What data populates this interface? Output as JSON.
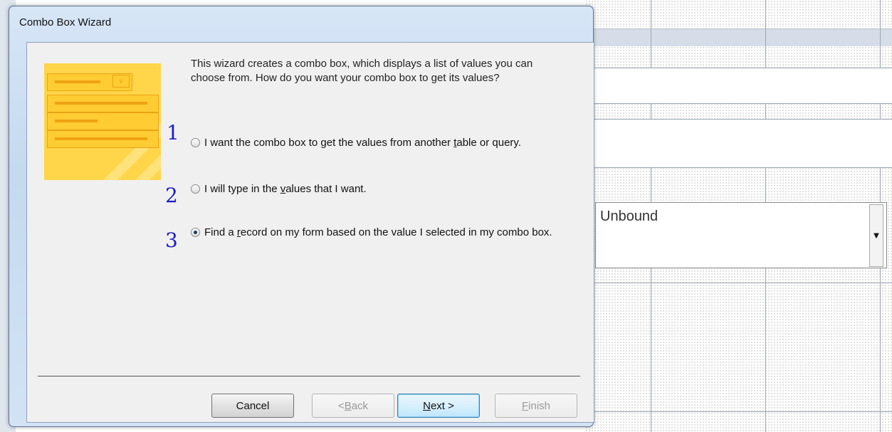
{
  "dialog": {
    "title": "Combo Box Wizard",
    "intro": "This wizard creates a combo box, which displays a list of values you can choose from.  How do you want your combo box to get its values?",
    "options": [
      {
        "pre": "I want the combo box to get the values from another ",
        "key": "t",
        "post": "able or query.",
        "selected": false,
        "annotation": "1"
      },
      {
        "pre": "I will type in the ",
        "key": "v",
        "post": "alues that I want.",
        "selected": false,
        "annotation": "2"
      },
      {
        "pre": "Find a ",
        "key": "r",
        "post": "ecord on my form based on the value I selected in my combo box.",
        "selected": true,
        "annotation": "3"
      }
    ],
    "buttons": {
      "cancel": "Cancel",
      "back_pre": "< ",
      "back_key": "B",
      "back_post": "ack",
      "next_key": "N",
      "next_post": "ext >",
      "finish_key": "F",
      "finish_post": "inish"
    }
  },
  "background": {
    "combo_value": "Unbound"
  },
  "colors": {
    "annotation": "#1c1cc8",
    "dialog_frame": "#c5d9ef",
    "art_yellow": "#ffd54a"
  }
}
